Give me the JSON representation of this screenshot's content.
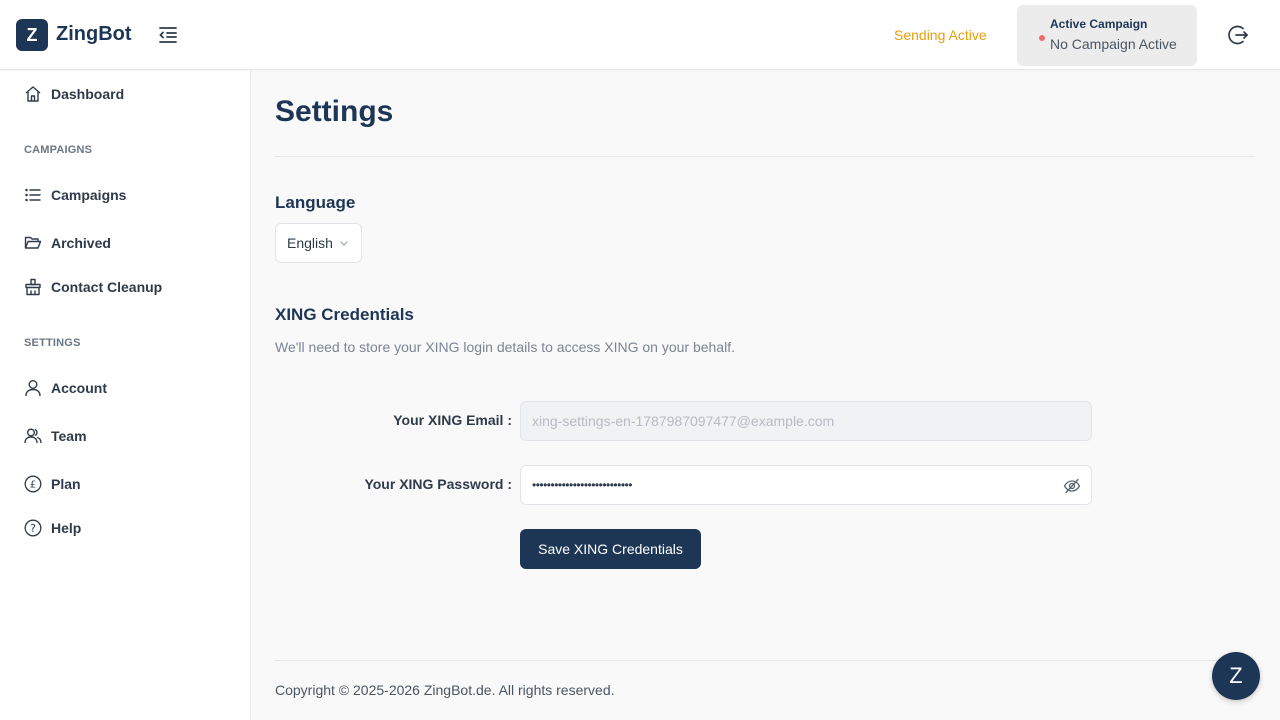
{
  "header": {
    "logo_letter": "Z",
    "app_name": "ZingBot",
    "sending_status": "Sending Active",
    "campaign_title": "Active Campaign",
    "campaign_value": "No Campaign Active"
  },
  "sidebar": {
    "dashboard": "Dashboard",
    "section_campaigns": "CAMPAIGNS",
    "campaigns": "Campaigns",
    "archived": "Archived",
    "contact_cleanup": "Contact Cleanup",
    "section_settings": "SETTINGS",
    "account": "Account",
    "team": "Team",
    "plan": "Plan",
    "help": "Help"
  },
  "main": {
    "title": "Settings",
    "language_heading": "Language",
    "language_value": "English",
    "credentials_heading": "XING Credentials",
    "credentials_desc": "We'll need to store your XING login details to access XING on your behalf.",
    "email_label": "Your XING Email :",
    "email_value": "xing-settings-en-1787987097477@example.com",
    "password_label": "Your XING Password :",
    "password_value": "•••••••••••••••••••••••••••",
    "save_button": "Save XING Credentials"
  },
  "footer": {
    "copyright": "Copyright © 2025-2026 ZingBot.de. All rights reserved."
  },
  "chat": {
    "letter": "Z"
  },
  "colors": {
    "brand": "#1e3656",
    "sending_active": "#e5a00d",
    "inactive_dot": "#f26b6b"
  }
}
